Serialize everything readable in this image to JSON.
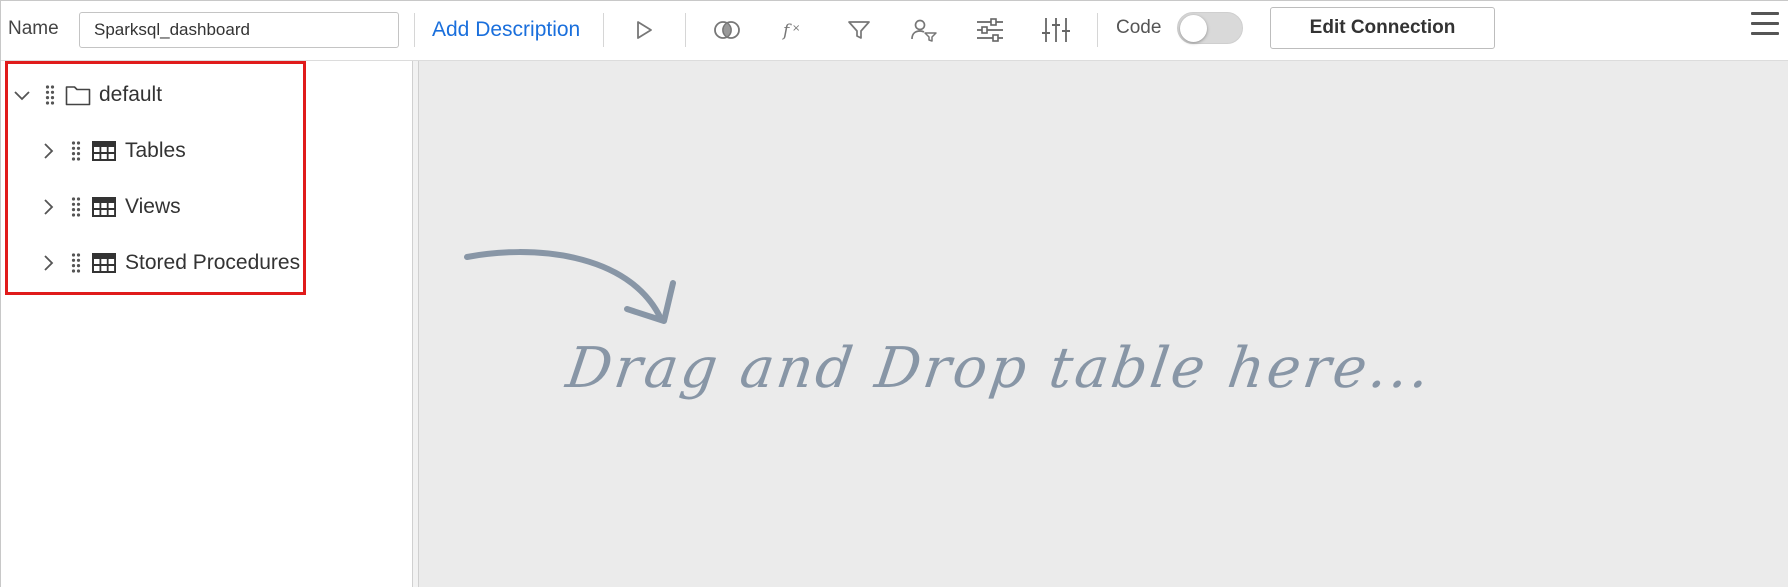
{
  "toolbar": {
    "name_label": "Name",
    "name_value": "Sparksql_dashboard",
    "add_description": "Add Description",
    "code_label": "Code",
    "code_enabled": false,
    "edit_connection": "Edit Connection",
    "icons": [
      "play-icon",
      "join-icon",
      "function-icon",
      "filter-icon",
      "user-filter-icon",
      "settings-sliders-icon",
      "column-sliders-icon",
      "hamburger-menu-icon"
    ]
  },
  "tree": {
    "root": {
      "label": "default",
      "expanded": true,
      "icon": "folder-icon"
    },
    "children": [
      {
        "label": "Tables",
        "expanded": false,
        "icon": "table-icon"
      },
      {
        "label": "Views",
        "expanded": false,
        "icon": "table-icon"
      },
      {
        "label": "Stored Procedures",
        "expanded": false,
        "icon": "table-icon"
      }
    ]
  },
  "canvas": {
    "hint": "Drag and Drop table here..."
  },
  "colors": {
    "accent_link": "#1a6fdc",
    "highlight_border": "#e01b1b",
    "canvas_bg": "#ebebeb",
    "hint_text": "#8896a6"
  }
}
